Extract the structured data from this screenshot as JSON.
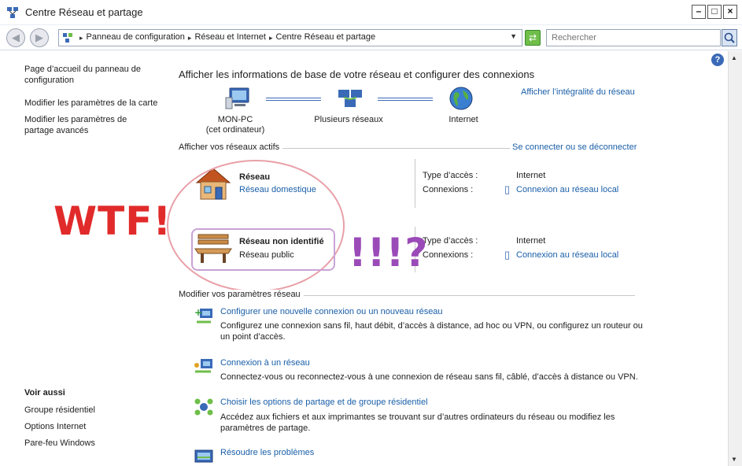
{
  "window": {
    "title": "Centre Réseau et partage"
  },
  "address": {
    "crumbs": [
      "Panneau de configuration",
      "Réseau et Internet",
      "Centre Réseau et partage"
    ],
    "search_placeholder": "Rechercher"
  },
  "sidebar": {
    "links": [
      "Page d’accueil du panneau de configuration",
      "Modifier les paramètres de la carte",
      "Modifier les paramètres de partage avancés"
    ],
    "see_also_title": "Voir aussi",
    "see_also": [
      "Groupe résidentiel",
      "Options Internet",
      "Pare-feu Windows"
    ]
  },
  "main": {
    "heading": "Afficher les informations de base de votre réseau et configurer des connexions",
    "full_map_link": "Afficher l’intégralité du réseau",
    "map": [
      {
        "label": "MON-PC",
        "sub": "(cet ordinateur)",
        "icon": "computer-icon"
      },
      {
        "label": "Plusieurs réseaux",
        "sub": "",
        "icon": "networks-icon"
      },
      {
        "label": "Internet",
        "sub": "",
        "icon": "globe-icon"
      }
    ],
    "active_title": "Afficher vos réseaux actifs",
    "connect_link": "Se connecter ou se déconnecter",
    "networks": [
      {
        "name": "Réseau",
        "type": "Réseau domestique",
        "access_label": "Type d’accès :",
        "access": "Internet",
        "conn_label": "Connexions :",
        "conn": "Connexion au réseau local",
        "icon": "house-icon"
      },
      {
        "name": "Réseau non identifié",
        "type": "Réseau public",
        "access_label": "Type d’accès :",
        "access": "Internet",
        "conn_label": "Connexions :",
        "conn": "Connexion au réseau local",
        "icon": "bench-icon"
      }
    ],
    "modify_title": "Modifier vos paramètres réseau",
    "tasks": [
      {
        "title": "Configurer une nouvelle connexion ou un nouveau réseau",
        "desc": "Configurez une connexion sans fil, haut débit, d’accès à distance, ad hoc ou VPN, ou configurez un routeur ou un point d’accès."
      },
      {
        "title": "Connexion à un réseau",
        "desc": "Connectez-vous ou reconnectez-vous à une connexion de réseau sans fil, câblé, d’accès à distance ou VPN."
      },
      {
        "title": "Choisir les options de partage et de groupe résidentiel",
        "desc": "Accédez aux fichiers et aux imprimantes se trouvant sur d’autres ordinateurs du réseau ou modifiez les paramètres de partage."
      },
      {
        "title": "Résoudre les problèmes",
        "desc": ""
      }
    ]
  },
  "annotations": {
    "wtf": "WTF!",
    "q": "!!!?"
  },
  "colors": {
    "link": "#1a5fa8",
    "wtf": "#e12a2a",
    "q": "#9b4bb8"
  }
}
